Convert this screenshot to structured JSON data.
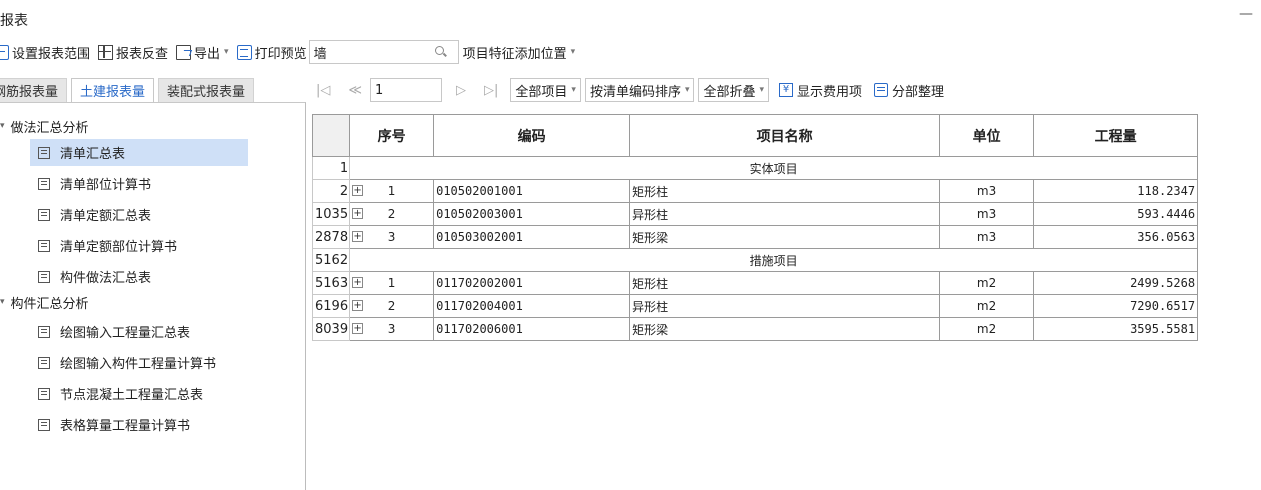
{
  "window": {
    "title": "报表"
  },
  "toolbar": {
    "set_range": "设置报表范围",
    "report_check": "报表反查",
    "export": "导出",
    "print_preview": "打印预览",
    "search_value": "墙",
    "feature_position": "项目特征添加位置"
  },
  "tabs": [
    {
      "label": "钢筋报表量"
    },
    {
      "label": "土建报表量"
    },
    {
      "label": "装配式报表量"
    }
  ],
  "tree": {
    "groups": [
      {
        "label": "做法汇总分析",
        "items": [
          "清单汇总表",
          "清单部位计算书",
          "清单定额汇总表",
          "清单定额部位计算书",
          "构件做法汇总表"
        ]
      },
      {
        "label": "构件汇总分析",
        "items": [
          "绘图输入工程量汇总表",
          "绘图输入构件工程量计算书",
          "节点混凝土工程量汇总表",
          "表格算量工程量计算书"
        ]
      }
    ]
  },
  "nav": {
    "page_value": "1",
    "scope": "全部项目",
    "sort": "按清单编码排序",
    "fold": "全部折叠",
    "show_fee": "显示费用项",
    "section_arrange": "分部整理"
  },
  "table": {
    "headers": [
      "序号",
      "编码",
      "项目名称",
      "单位",
      "工程量"
    ],
    "rows": [
      {
        "rownum": "1",
        "section": "实体项目"
      },
      {
        "rownum": "2",
        "seq": "1",
        "code": "010502001001",
        "name": "矩形柱",
        "unit": "m3",
        "qty": "118.2347"
      },
      {
        "rownum": "1035",
        "seq": "2",
        "code": "010502003001",
        "name": "异形柱",
        "unit": "m3",
        "qty": "593.4446"
      },
      {
        "rownum": "2878",
        "seq": "3",
        "code": "010503002001",
        "name": "矩形梁",
        "unit": "m3",
        "qty": "356.0563"
      },
      {
        "rownum": "5162",
        "section": "措施项目"
      },
      {
        "rownum": "5163",
        "seq": "1",
        "code": "011702002001",
        "name": "矩形柱",
        "unit": "m2",
        "qty": "2499.5268"
      },
      {
        "rownum": "6196",
        "seq": "2",
        "code": "011702004001",
        "name": "异形柱",
        "unit": "m2",
        "qty": "7290.6517"
      },
      {
        "rownum": "8039",
        "seq": "3",
        "code": "011702006001",
        "name": "矩形梁",
        "unit": "m2",
        "qty": "3595.5581"
      }
    ]
  }
}
